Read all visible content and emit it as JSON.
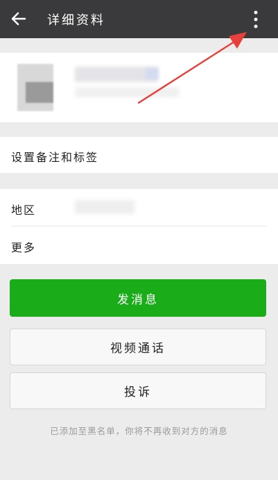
{
  "header": {
    "title": "详细资料",
    "back_icon": "arrow-left-icon",
    "more_icon": "more-vertical-icon"
  },
  "profile": {
    "avatar_icon": "avatar-image"
  },
  "rows": {
    "remark_label": "设置备注和标签",
    "region_label": "地区",
    "more_label": "更多"
  },
  "buttons": {
    "send_message": "发消息",
    "video_call": "视频通话",
    "report": "投诉"
  },
  "footer": {
    "note": "已添加至黑名单，你将不再收到对方的消息"
  },
  "colors": {
    "topbar": "#3a3a3c",
    "primary_green": "#1aad19",
    "background": "#ececec",
    "annotation_red": "#e8403a"
  }
}
